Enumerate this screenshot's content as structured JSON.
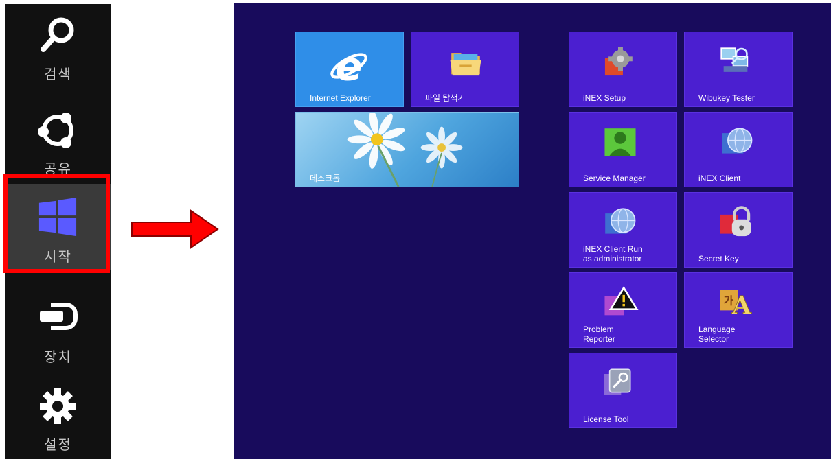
{
  "charms": [
    {
      "label": "검색",
      "icon": "search-icon"
    },
    {
      "label": "공유",
      "icon": "share-icon"
    },
    {
      "label": "시작",
      "icon": "windows-start-icon",
      "active": true
    },
    {
      "label": "장치",
      "icon": "devices-icon"
    },
    {
      "label": "설정",
      "icon": "settings-gear-icon"
    }
  ],
  "arrow": {
    "color": "#ff0000",
    "icon": "right-arrow-icon"
  },
  "highlight": {
    "color": "#ff0000"
  },
  "start_screen": {
    "background": "#180b5c",
    "tile_color": "#4b1fd0",
    "groups": [
      {
        "tiles": [
          {
            "label": "Internet Explorer",
            "icon": "internet-explorer-icon",
            "color": "#2f8ee8"
          },
          {
            "label": "파일 탐색기",
            "icon": "folder-icon"
          },
          {
            "label": "데스크톱",
            "icon": "desktop-wallpaper"
          }
        ]
      },
      {
        "tiles": [
          {
            "label": "iNEX Setup",
            "icon": "gear-icon"
          },
          {
            "label": "Wibukey Tester",
            "icon": "network-tester-icon"
          },
          {
            "label": "Service Manager",
            "icon": "user-icon"
          },
          {
            "label": "iNEX Client",
            "icon": "globe-icon"
          },
          {
            "label": "iNEX Client Run\nas administrator",
            "icon": "globe-icon"
          },
          {
            "label": "Secret Key",
            "icon": "padlock-icon"
          },
          {
            "label": "Problem\nReporter",
            "icon": "warning-icon"
          },
          {
            "label": "Language\nSelector",
            "icon": "language-icon"
          },
          {
            "label": "License Tool",
            "icon": "wrench-icon"
          }
        ]
      }
    ]
  }
}
